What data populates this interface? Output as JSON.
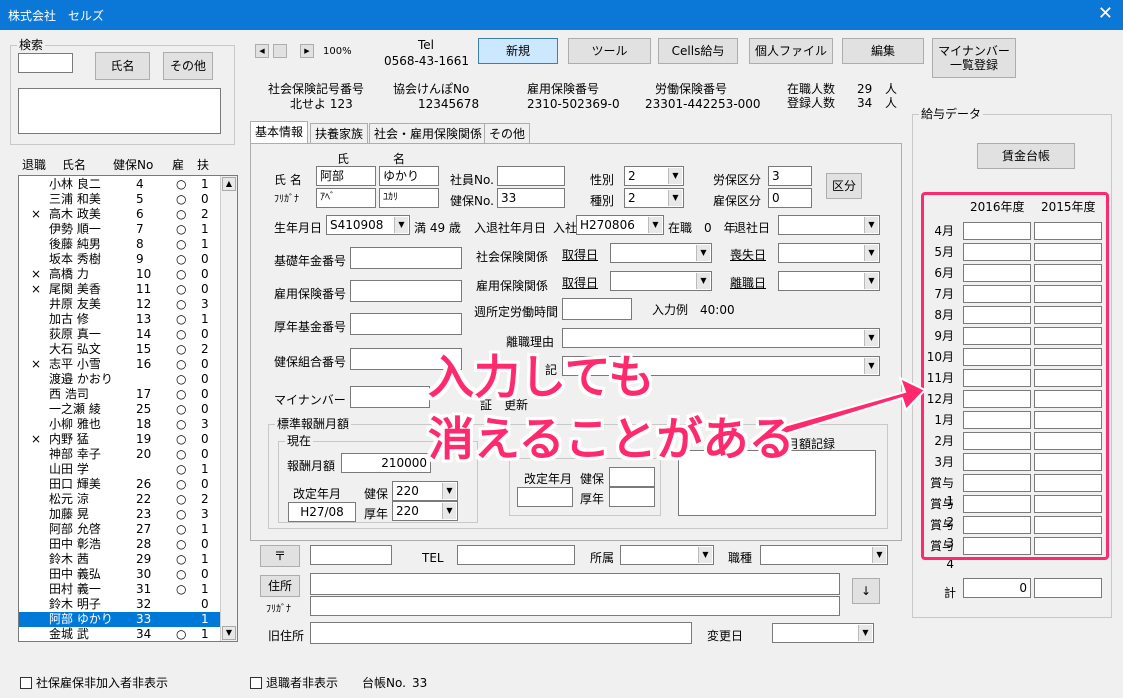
{
  "window": {
    "title": "株式会社　セルズ",
    "close": "✕"
  },
  "search": {
    "caption": "検索",
    "name_btn": "氏名",
    "other_btn": "その他"
  },
  "list": {
    "headers": [
      "退職",
      "氏名",
      "健保No",
      "雇",
      "扶"
    ],
    "rows": [
      {
        "ret": "",
        "name": "小林 良二",
        "no": "4",
        "ko": "○",
        "fu": "1"
      },
      {
        "ret": "",
        "name": "三浦 和美",
        "no": "5",
        "ko": "○",
        "fu": "0"
      },
      {
        "ret": "×",
        "name": "高木 政美",
        "no": "6",
        "ko": "○",
        "fu": "2"
      },
      {
        "ret": "",
        "name": "伊勢 順一",
        "no": "7",
        "ko": "○",
        "fu": "1"
      },
      {
        "ret": "",
        "name": "後藤 純男",
        "no": "8",
        "ko": "○",
        "fu": "1"
      },
      {
        "ret": "",
        "name": "坂本 秀樹",
        "no": "9",
        "ko": "○",
        "fu": "0"
      },
      {
        "ret": "×",
        "name": "高橋 力",
        "no": "10",
        "ko": "○",
        "fu": "0"
      },
      {
        "ret": "×",
        "name": "尾関 美香",
        "no": "11",
        "ko": "○",
        "fu": "0"
      },
      {
        "ret": "",
        "name": "井原 友美",
        "no": "12",
        "ko": "○",
        "fu": "3"
      },
      {
        "ret": "",
        "name": "加古 修",
        "no": "13",
        "ko": "○",
        "fu": "1"
      },
      {
        "ret": "",
        "name": "荻原 真一",
        "no": "14",
        "ko": "○",
        "fu": "0"
      },
      {
        "ret": "",
        "name": "大石 弘文",
        "no": "15",
        "ko": "○",
        "fu": "2"
      },
      {
        "ret": "×",
        "name": "志平 小雪",
        "no": "16",
        "ko": "○",
        "fu": "0"
      },
      {
        "ret": "",
        "name": "渡邉 かおり",
        "no": "",
        "ko": "○",
        "fu": "0"
      },
      {
        "ret": "",
        "name": "西 浩司",
        "no": "17",
        "ko": "○",
        "fu": "0"
      },
      {
        "ret": "",
        "name": "一之瀬 綾",
        "no": "25",
        "ko": "○",
        "fu": "0"
      },
      {
        "ret": "",
        "name": "小柳 雅也",
        "no": "18",
        "ko": "○",
        "fu": "3"
      },
      {
        "ret": "×",
        "name": "内野 猛",
        "no": "19",
        "ko": "○",
        "fu": "0"
      },
      {
        "ret": "",
        "name": "神部 幸子",
        "no": "20",
        "ko": "○",
        "fu": "0"
      },
      {
        "ret": "",
        "name": "山田 学",
        "no": "",
        "ko": "○",
        "fu": "1"
      },
      {
        "ret": "",
        "name": "田口 輝美",
        "no": "26",
        "ko": "○",
        "fu": "0"
      },
      {
        "ret": "",
        "name": "松元 涼",
        "no": "22",
        "ko": "○",
        "fu": "2"
      },
      {
        "ret": "",
        "name": "加藤 晃",
        "no": "23",
        "ko": "○",
        "fu": "3"
      },
      {
        "ret": "",
        "name": "阿部 允啓",
        "no": "27",
        "ko": "○",
        "fu": "1"
      },
      {
        "ret": "",
        "name": "田中 彰浩",
        "no": "28",
        "ko": "○",
        "fu": "0"
      },
      {
        "ret": "",
        "name": "鈴木 茜",
        "no": "29",
        "ko": "○",
        "fu": "1"
      },
      {
        "ret": "",
        "name": "田中 義弘",
        "no": "30",
        "ko": "○",
        "fu": "0"
      },
      {
        "ret": "",
        "name": "田村 義一",
        "no": "31",
        "ko": "○",
        "fu": "1"
      },
      {
        "ret": "",
        "name": "鈴木 明子",
        "no": "32",
        "ko": "",
        "fu": "0"
      },
      {
        "ret": "",
        "name": "阿部 ゆかり",
        "no": "33",
        "ko": "",
        "fu": "1"
      },
      {
        "ret": "",
        "name": "金城 武",
        "no": "34",
        "ko": "○",
        "fu": "1"
      }
    ],
    "selected_index": 29
  },
  "bottom": {
    "hide_unenrolled": "社保雇保非加入者非表示",
    "hide_retired": "退職者非表示",
    "ledger_no_label": "台帳No.",
    "ledger_no": "33"
  },
  "toolbar": {
    "zoom": "100%",
    "tel_label": "Tel",
    "tel": "0568-43-1661",
    "new": "新規",
    "tool": "ツール",
    "cells": "Cells給与",
    "personal_file": "個人ファイル",
    "edit": "編集",
    "mynumber": "マイナンバー\n一覧登録"
  },
  "company": {
    "shaho_label": "社会保険記号番号",
    "shaho": "北せよ 123",
    "kyokai_label": "協会けんぽNo",
    "kyokai": "12345678",
    "koyo_label": "雇用保険番号",
    "koyo": "2310-502369-0",
    "rodo_label": "労働保険番号",
    "rodo": "23301-442253-000",
    "zaishoku_label": "在職人数",
    "zaishoku": "29",
    "toroku_label": "登録人数",
    "toroku": "34",
    "nin": "人"
  },
  "tabs": [
    "基本情報",
    "扶養家族",
    "社会・雇用保険関係",
    "その他"
  ],
  "basic": {
    "uji": "氏",
    "mei": "名",
    "name_label": "氏 名",
    "last": "阿部",
    "first": "ゆかり",
    "kana_label": "ﾌﾘｶﾞﾅ",
    "last_kana": "ｱﾍﾞ",
    "first_kana": "ﾕｶﾘ",
    "emp_no_label": "社員No.",
    "emp_no": "",
    "kenpo_no_label": "健保No.",
    "kenpo_no": "33",
    "sex_label": "性別",
    "sex": "2",
    "kind_label": "種別",
    "kind": "2",
    "rouho_label": "労保区分",
    "rouho": "3",
    "koho_label": "雇保区分",
    "koho": "0",
    "kubun_btn": "区分",
    "birth_label": "生年月日",
    "birth": "S410908",
    "age": "満 49 歳",
    "join_label": "入退社年月日",
    "join_prefix": "入社",
    "join": "H270806",
    "tenure": "在職　0　年",
    "leave_label": "退社日",
    "kiso_label": "基礎年金番号",
    "koyo_label": "雇用保険番号",
    "kosei_label": "厚年基金番号",
    "kumiai_label": "健保組合番号",
    "mynumber_label": "マイナンバー",
    "shaho_rel": "社会保険関係",
    "koyo_rel": "雇用保険関係",
    "get_date": "取得日",
    "lose_date": "喪失日",
    "leave_date": "離職日",
    "weekly_label": "週所定労働時間",
    "weekly_example": "入力例　40:00",
    "reason_label": "離職理由",
    "note_fragment": "記",
    "cert_fragment": "証　更新",
    "std_caption": "標準報酬月額",
    "current": "現在",
    "monthly_label": "報酬月額",
    "monthly": "210000",
    "revise_label": "改定年月",
    "revise": "H27/08",
    "kenpo": "健保",
    "kenpo_val": "220",
    "kosei": "厚年",
    "kosei_val": "220",
    "revise_label2": "改定年月",
    "kenpo2": "健保",
    "kosei2": "厚年",
    "record_fragment": "酬月額記録",
    "zip_btn": "〒",
    "tel_label": "TEL",
    "dept_label": "所属",
    "job_label": "職種",
    "addr_btn": "住所",
    "addr_kana": "ﾌﾘｶﾞﾅ",
    "down_btn": "↓",
    "old_addr_label": "旧住所",
    "change_label": "変更日"
  },
  "salary": {
    "caption": "給与データ",
    "ledger_btn": "賃金台帳",
    "years": [
      "2016年度",
      "2015年度"
    ],
    "months": [
      "4月",
      "5月",
      "6月",
      "7月",
      "8月",
      "9月",
      "10月",
      "11月",
      "12月",
      "1月",
      "2月",
      "3月",
      "賞与1",
      "賞与2",
      "賞与3",
      "賞与4"
    ],
    "total_label": "計",
    "total": "0"
  },
  "callout": {
    "line1": "入力しても",
    "line2": "消えることがある",
    "color": "#ff2a6d"
  }
}
